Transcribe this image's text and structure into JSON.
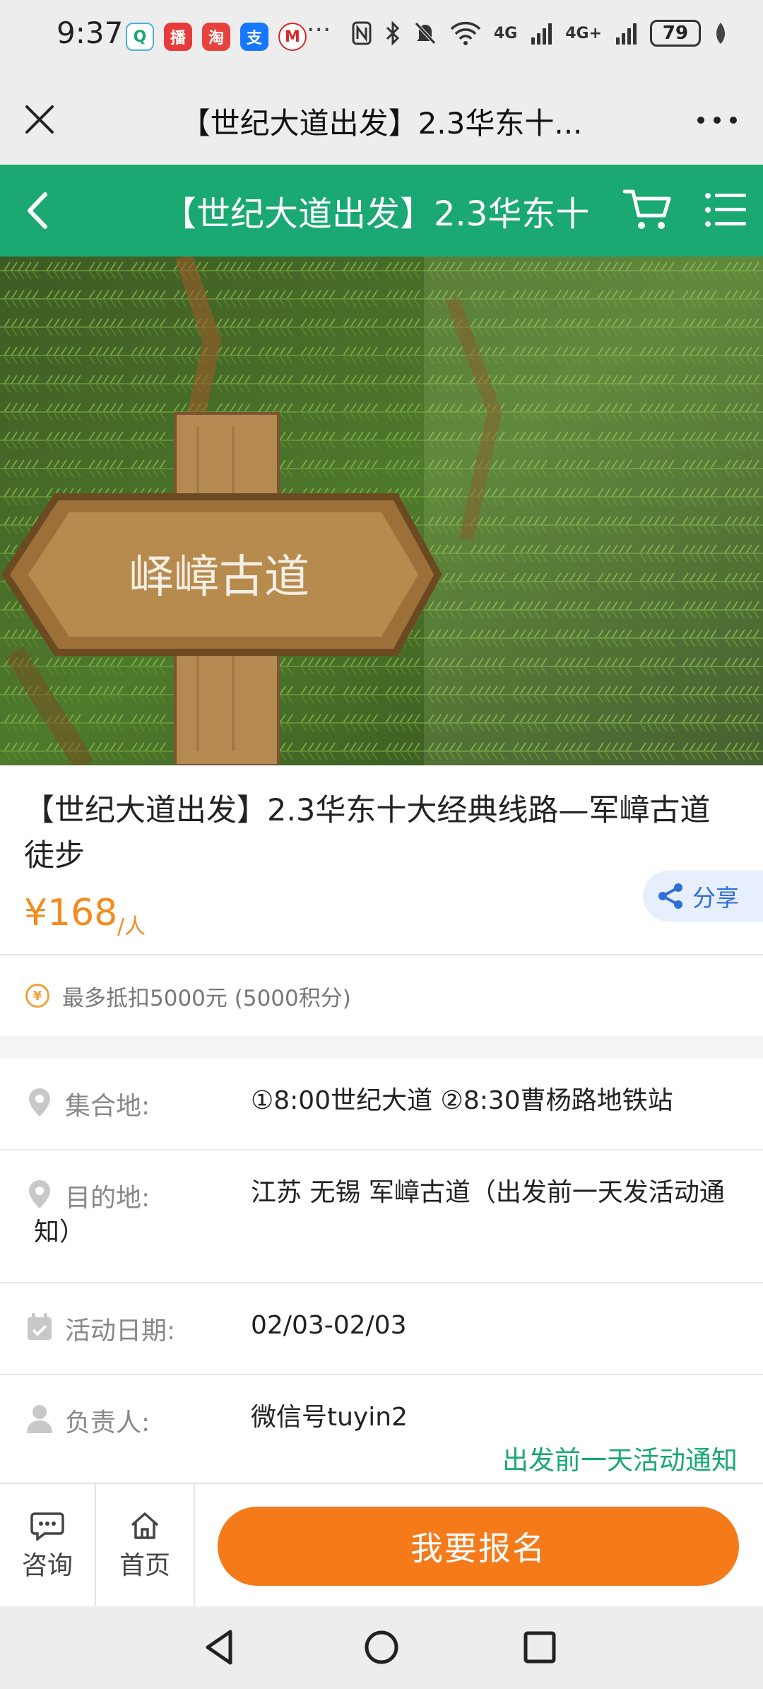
{
  "status_bar": {
    "time": "9:37",
    "apps": [
      {
        "icon": "chat-app-icon",
        "glyph": "Q",
        "color": "#ffffff"
      },
      {
        "icon": "news-app-icon",
        "glyph": "播",
        "color": "#e63b3b"
      },
      {
        "icon": "shop-app-icon",
        "glyph": "淘",
        "color": "#e8423e"
      },
      {
        "icon": "alipay-icon",
        "glyph": "支",
        "color": "#1677ff"
      },
      {
        "icon": "metro-app-icon",
        "glyph": "M",
        "color": "#d62828"
      }
    ],
    "more_glyph": "···",
    "signal_1": "4G",
    "signal_2": "4G+",
    "battery": "79"
  },
  "web_bar": {
    "title": "【世纪大道出发】2.3华东十..."
  },
  "header": {
    "title": "【世纪大道出发】2.3华东十",
    "accent_color": "#1aa873"
  },
  "hero": {
    "sign_text": "峄嶂古道"
  },
  "product": {
    "title": "【世纪大道出发】2.3华东十大经典线路—军嶂古道徒步",
    "price": "¥168",
    "price_unit": "/人",
    "share_label": "分享",
    "points_text": "最多抵扣5000元 (5000积分)"
  },
  "info": [
    {
      "icon": "location-pin-icon",
      "label": "集合地:",
      "value": "①8:00世纪大道 ②8:30曹杨路地铁站"
    },
    {
      "icon": "location-pin-icon",
      "label": "目的地:",
      "value": "江苏 无锡 军嶂古道（出发前一天发活动通知）"
    },
    {
      "icon": "calendar-icon",
      "label": "活动日期:",
      "value": "02/03-02/03"
    },
    {
      "icon": "person-icon",
      "label": "负责人:",
      "value": "微信号tuyin2"
    }
  ],
  "notice": "出发前一天活动通知",
  "actions": {
    "consult_label": "咨询",
    "home_label": "首页",
    "signup_label": "我要报名",
    "signup_color": "#f47a1a"
  }
}
